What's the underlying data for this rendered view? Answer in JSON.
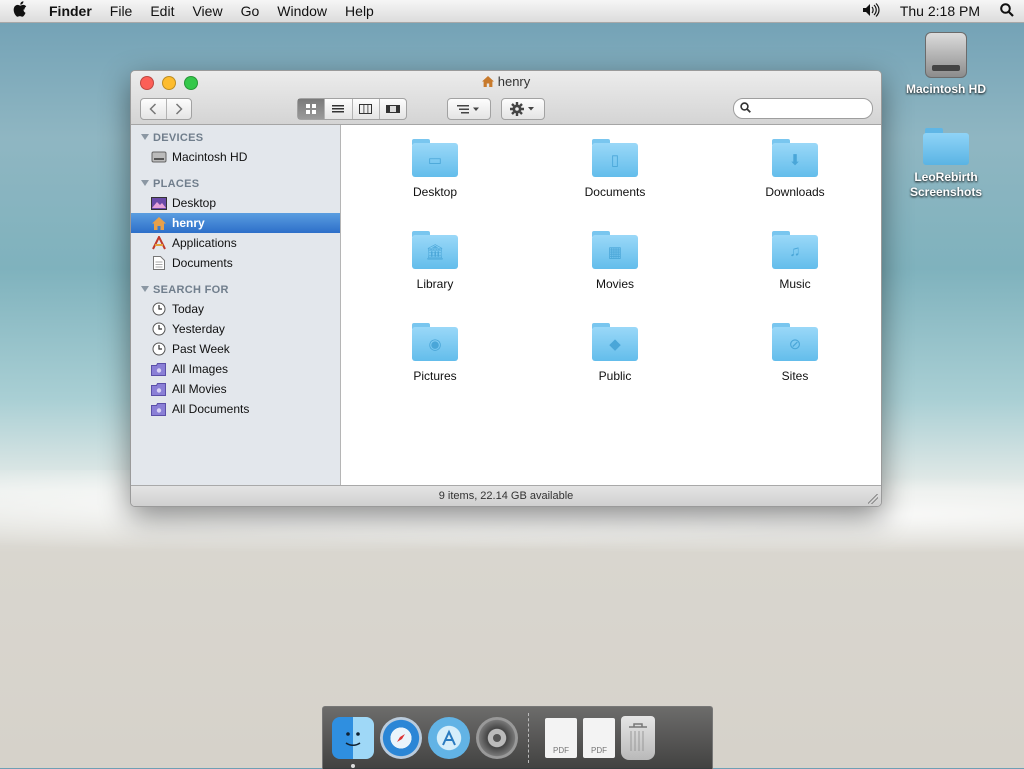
{
  "menubar": {
    "app_name": "Finder",
    "items": [
      "File",
      "Edit",
      "View",
      "Go",
      "Window",
      "Help"
    ],
    "clock": "Thu 2:18 PM"
  },
  "desktop": {
    "icons": [
      {
        "label": "Macintosh HD"
      },
      {
        "label": "LeoRebirth Screenshots"
      }
    ]
  },
  "window": {
    "title": "henry",
    "search_placeholder": "",
    "status": "9 items, 22.14 GB available"
  },
  "sidebar": {
    "sections": [
      {
        "title": "DEVICES",
        "items": [
          {
            "label": "Macintosh HD",
            "icon": "hard-drive-icon"
          }
        ]
      },
      {
        "title": "PLACES",
        "items": [
          {
            "label": "Desktop",
            "icon": "desktop-icon"
          },
          {
            "label": "henry",
            "icon": "home-icon",
            "selected": true
          },
          {
            "label": "Applications",
            "icon": "applications-icon"
          },
          {
            "label": "Documents",
            "icon": "document-icon"
          }
        ]
      },
      {
        "title": "SEARCH FOR",
        "items": [
          {
            "label": "Today",
            "icon": "clock-icon"
          },
          {
            "label": "Yesterday",
            "icon": "clock-icon"
          },
          {
            "label": "Past Week",
            "icon": "clock-icon"
          },
          {
            "label": "All Images",
            "icon": "smart-folder-icon"
          },
          {
            "label": "All Movies",
            "icon": "smart-folder-icon"
          },
          {
            "label": "All Documents",
            "icon": "smart-folder-icon"
          }
        ]
      }
    ]
  },
  "content": {
    "folders": [
      {
        "label": "Desktop",
        "icon": "desktop-folder-icon"
      },
      {
        "label": "Documents",
        "icon": "documents-folder-icon"
      },
      {
        "label": "Downloads",
        "icon": "downloads-folder-icon"
      },
      {
        "label": "Library",
        "icon": "library-folder-icon"
      },
      {
        "label": "Movies",
        "icon": "movies-folder-icon"
      },
      {
        "label": "Music",
        "icon": "music-folder-icon"
      },
      {
        "label": "Pictures",
        "icon": "pictures-folder-icon"
      },
      {
        "label": "Public",
        "icon": "public-folder-icon"
      },
      {
        "label": "Sites",
        "icon": "sites-folder-icon"
      }
    ]
  },
  "dock": {
    "pdf_label": "PDF"
  },
  "colors": {
    "selection": "#3b82d8",
    "folder": "#6cc1ee",
    "sidebar_bg": "#e3e7ec"
  }
}
